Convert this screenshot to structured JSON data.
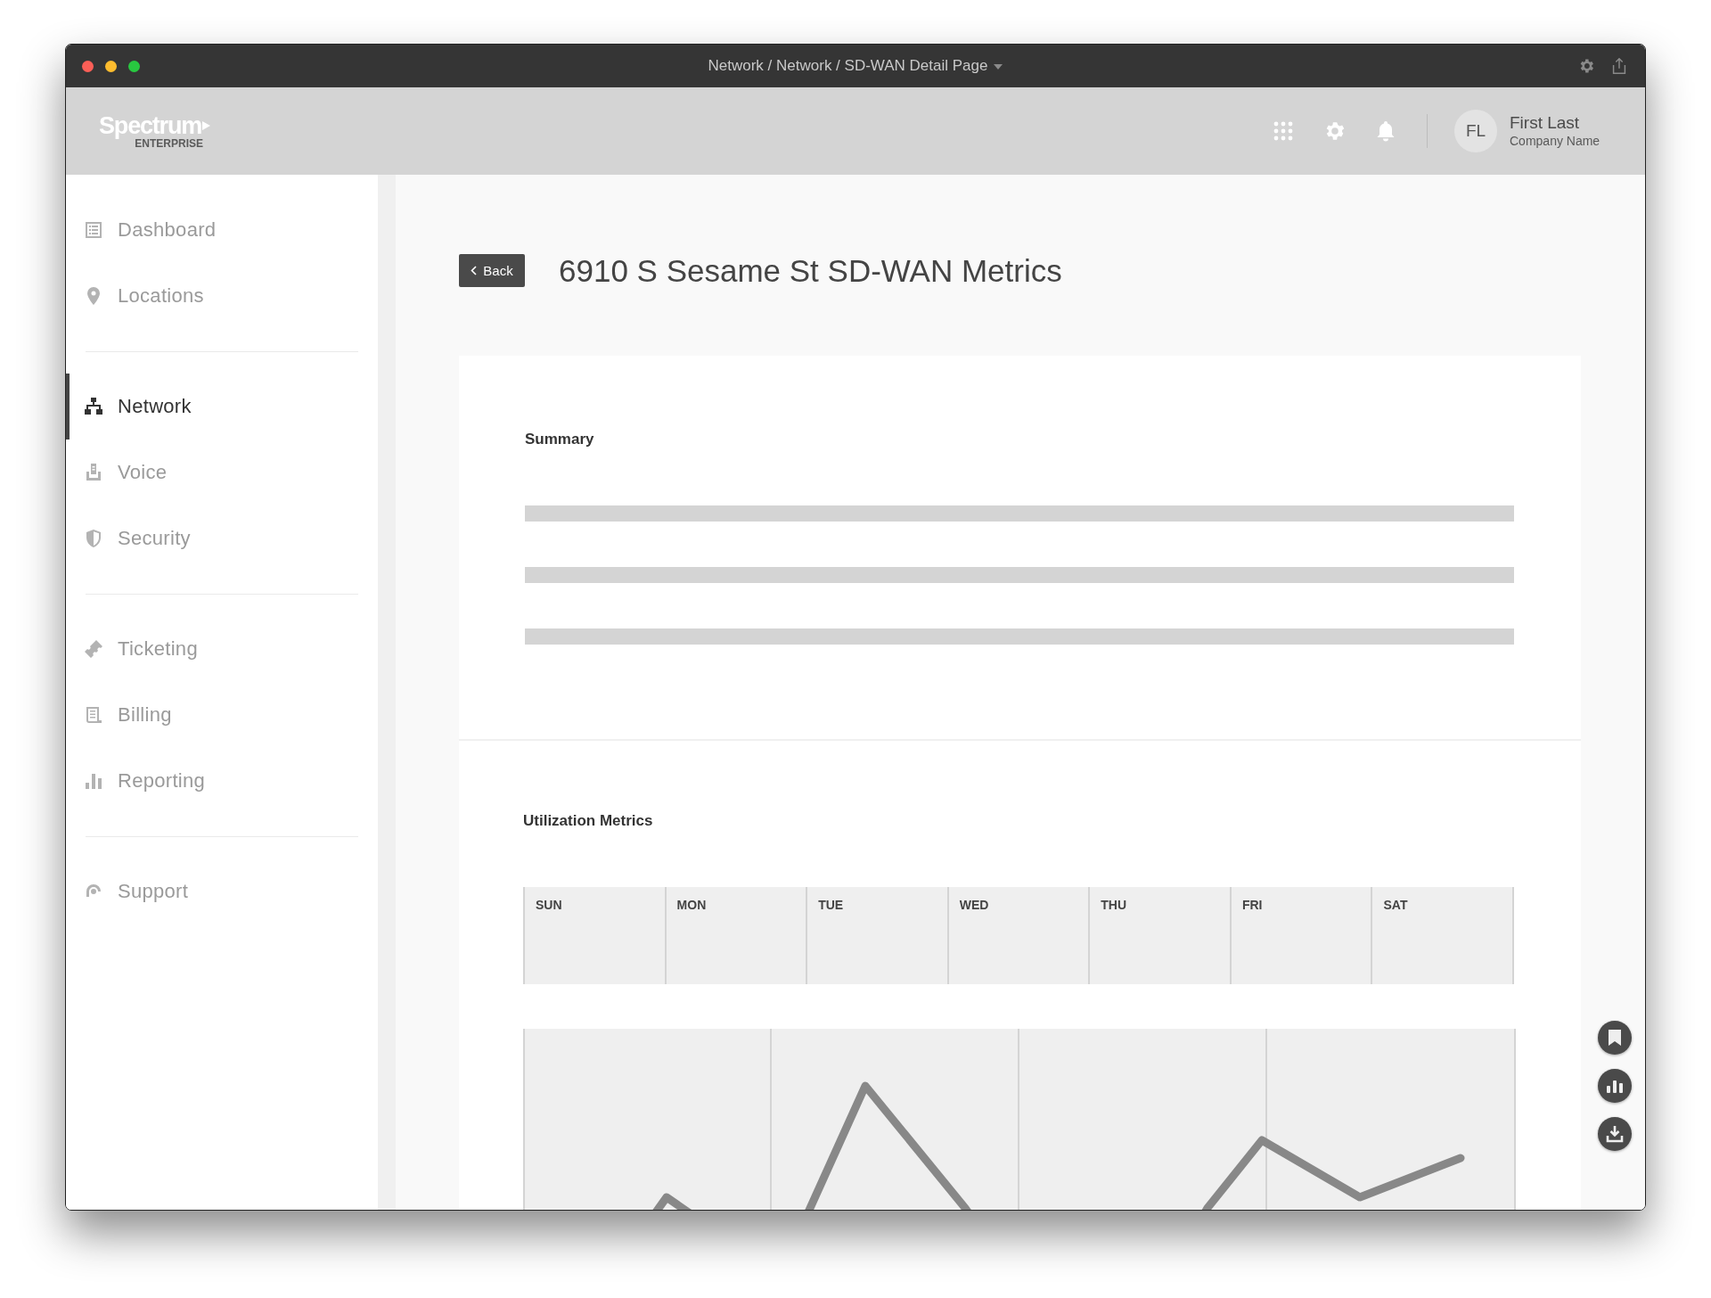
{
  "window": {
    "title": "Network / Network / SD-WAN Detail Page"
  },
  "header": {
    "logo": {
      "name": "Spectrum",
      "sub": "ENTERPRISE"
    },
    "user": {
      "initials": "FL",
      "name": "First Last",
      "company": "Company Name"
    }
  },
  "sidebar": {
    "groups": [
      {
        "items": [
          {
            "label": "Dashboard",
            "selected": false
          },
          {
            "label": "Locations",
            "selected": false
          }
        ]
      },
      {
        "items": [
          {
            "label": "Network",
            "selected": true
          },
          {
            "label": "Voice",
            "selected": false
          },
          {
            "label": "Security",
            "selected": false
          }
        ]
      },
      {
        "items": [
          {
            "label": "Ticketing",
            "selected": false
          },
          {
            "label": "Billing",
            "selected": false
          },
          {
            "label": "Reporting",
            "selected": false
          }
        ]
      },
      {
        "items": [
          {
            "label": "Support",
            "selected": false
          }
        ]
      }
    ]
  },
  "page": {
    "back": "Back",
    "title": "6910 S Sesame St SD-WAN Metrics"
  },
  "summary": {
    "title": "Summary"
  },
  "utilization": {
    "title": "Utilization Metrics",
    "days": [
      "SUN",
      "MON",
      "TUE",
      "WED",
      "THU",
      "FRI",
      "SAT"
    ]
  }
}
